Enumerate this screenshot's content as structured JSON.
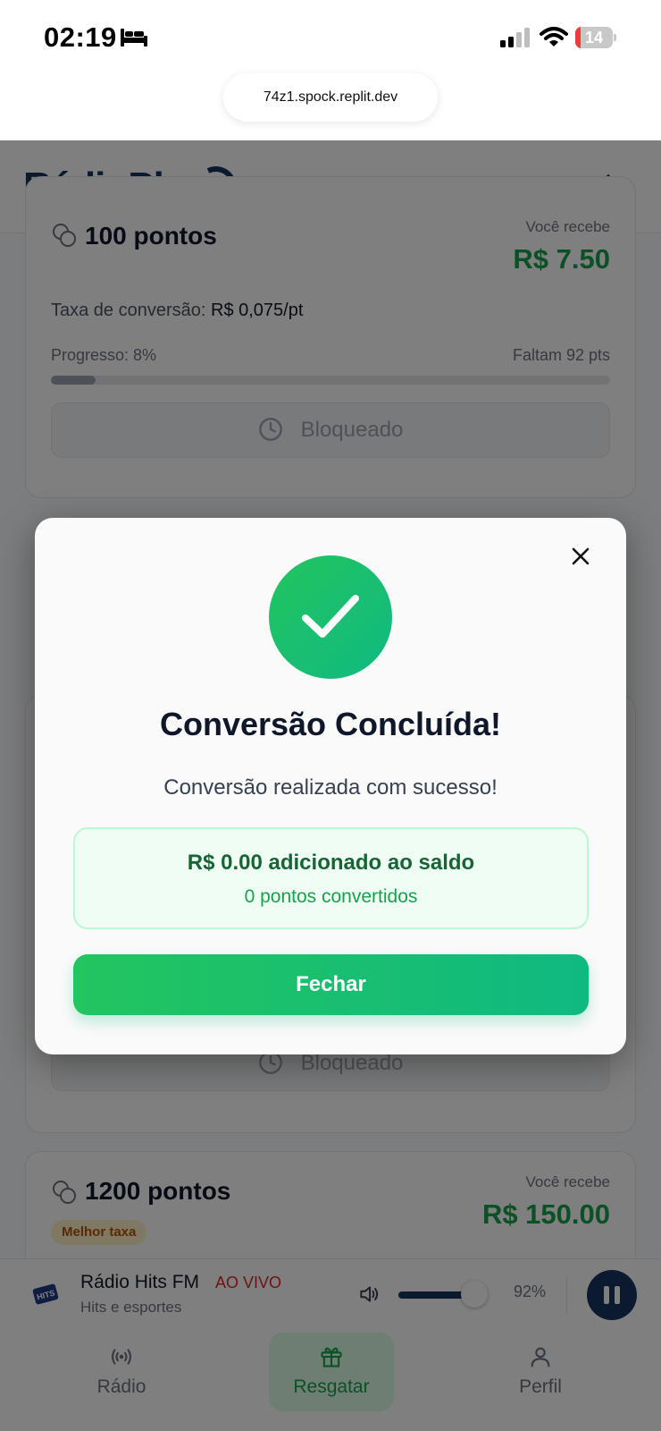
{
  "status_bar": {
    "time": "02:19",
    "battery": "14",
    "battery_level": 0.14,
    "url": "74z1.spock.replit.dev"
  },
  "header": {
    "logo": "RádioPlay",
    "settings_icon": "gear-icon"
  },
  "cards": [
    {
      "points": "100 pontos",
      "receive_label": "Você recebe",
      "receive_value": "R$ 7.50",
      "rate_label": "Taxa de conversão:",
      "rate_value": "R$ 0,075/pt",
      "progress_label": "Progresso: 8%",
      "progress": 0.08,
      "remaining": "Faltam 92 pts",
      "button": "Bloqueado"
    },
    {
      "button": "Bloqueado"
    },
    {
      "points": "1200 pontos",
      "badge": "Melhor taxa",
      "receive_label": "Você recebe",
      "receive_value": "R$ 150.00"
    }
  ],
  "player": {
    "station": "Rádio Hits FM",
    "live": "AO VIVO",
    "subtitle": "Hits e esportes",
    "volume": 0.92,
    "volume_label": "92%"
  },
  "nav": [
    {
      "label": "Rádio",
      "icon": "radio-icon",
      "active": false
    },
    {
      "label": "Resgatar",
      "icon": "gift-icon",
      "active": true
    },
    {
      "label": "Perfil",
      "icon": "user-icon",
      "active": false
    }
  ],
  "modal": {
    "title": "Conversão Concluída!",
    "message": "Conversão realizada com sucesso!",
    "amount": "R$ 0.00 adicionado ao saldo",
    "points": "0 pontos convertidos",
    "button": "Fechar"
  },
  "colors": {
    "brand": "#16345c",
    "success": "#22c55e",
    "success_text": "#166534"
  }
}
